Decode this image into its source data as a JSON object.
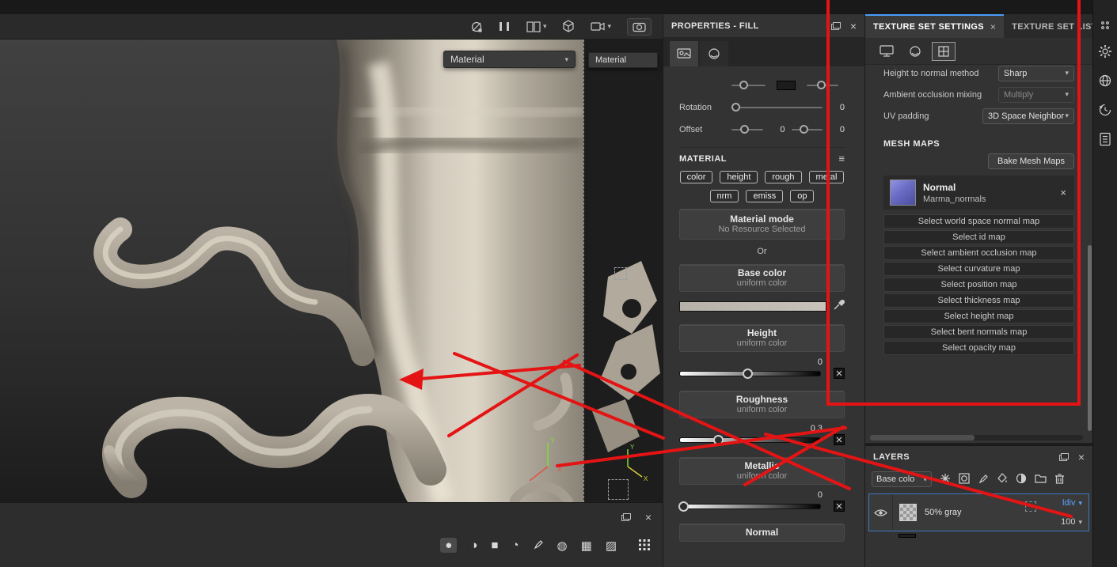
{
  "ui": {
    "close": "×",
    "caret": "▾",
    "menu": "≡"
  },
  "colors": {
    "accent_blue": "#4a9df8",
    "annotation_red": "#e51414",
    "blend_blue": "#5aa2ff"
  },
  "viewport": {
    "material_label": "Material",
    "strip_label": "Material",
    "gizmo": {
      "x": "X",
      "y": "Y"
    }
  },
  "properties": {
    "title": "PROPERTIES - FILL",
    "rotation_label": "Rotation",
    "rotation_value": "0",
    "offset_label": "Offset",
    "offset_value_x": "0",
    "offset_value_y": "0",
    "material_header": "MATERIAL",
    "channels_row1": [
      "color",
      "height",
      "rough",
      "metal"
    ],
    "channels_row2": [
      "nrm",
      "emiss",
      "op"
    ],
    "material_mode_title": "Material mode",
    "material_mode_sub": "No Resource Selected",
    "or_label": "Or",
    "base_color_title": "Base color",
    "base_color_sub": "uniform color",
    "height_title": "Height",
    "height_sub": "uniform color",
    "height_value": "0",
    "roughness_title": "Roughness",
    "roughness_sub": "uniform color",
    "roughness_value": "0.3",
    "metallic_title": "Metallic",
    "metallic_sub": "uniform color",
    "metallic_value": "0",
    "normal_title": "Normal"
  },
  "textureSet": {
    "tab_settings": "TEXTURE SET SETTINGS",
    "tab_list": "TEXTURE SET LIST",
    "rows": [
      {
        "label": "Height to normal method",
        "value": "Sharp"
      },
      {
        "label": "Ambient occlusion mixing",
        "value": "Multiply"
      },
      {
        "label": "UV padding",
        "value": "3D Space Neighbor"
      }
    ],
    "mesh_maps_header": "MESH MAPS",
    "bake_button": "Bake Mesh Maps",
    "normal_map_name": "Normal",
    "normal_map_res": "Marma_normals",
    "select_buttons": [
      "Select world space normal map",
      "Select id map",
      "Select ambient occlusion map",
      "Select curvature map",
      "Select position map",
      "Select thickness map",
      "Select height map",
      "Select bent normals map",
      "Select opacity map"
    ]
  },
  "layers": {
    "title": "LAYERS",
    "filter_value": "Base colo",
    "layer_name": "50% gray",
    "blend_mode": "ldiv",
    "opacity": "100"
  }
}
